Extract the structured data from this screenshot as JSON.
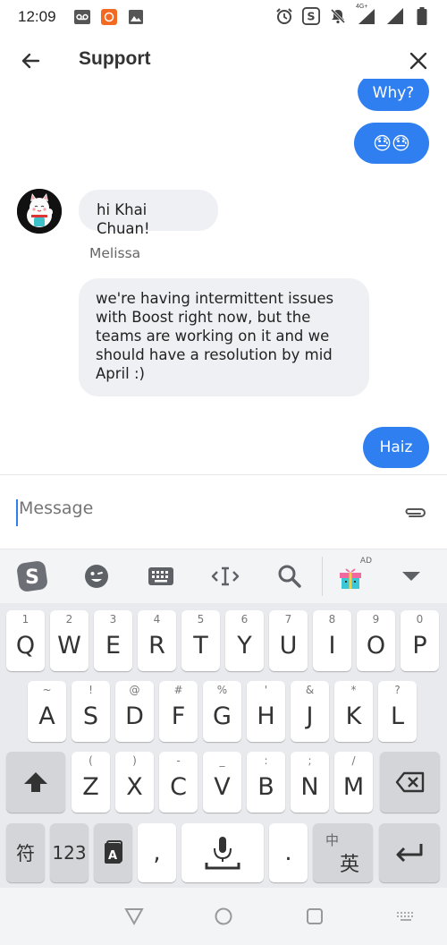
{
  "status_bar": {
    "time": "12:09",
    "net_label": "4G+"
  },
  "header": {
    "title": "Support"
  },
  "messages": [
    {
      "side": "out",
      "text": "Why?"
    },
    {
      "side": "out",
      "text": "😓😓"
    },
    {
      "side": "in",
      "text": "hi Khai Chuan!"
    },
    {
      "side": "in",
      "sender": "Melissa",
      "text": "we're having intermittent issues with Boost right now, but the teams are working on it and we should have a resolution by mid April :)"
    },
    {
      "side": "out",
      "text": "Haiz"
    }
  ],
  "composer": {
    "placeholder": "Message"
  },
  "keyboard": {
    "toolbar_ad": "AD",
    "row1": [
      {
        "hint": "1",
        "key": "Q"
      },
      {
        "hint": "2",
        "key": "W"
      },
      {
        "hint": "3",
        "key": "E"
      },
      {
        "hint": "4",
        "key": "R"
      },
      {
        "hint": "5",
        "key": "T"
      },
      {
        "hint": "6",
        "key": "Y"
      },
      {
        "hint": "7",
        "key": "U"
      },
      {
        "hint": "8",
        "key": "I"
      },
      {
        "hint": "9",
        "key": "O"
      },
      {
        "hint": "0",
        "key": "P"
      }
    ],
    "row2": [
      {
        "hint": "~",
        "key": "A"
      },
      {
        "hint": "!",
        "key": "S"
      },
      {
        "hint": "@",
        "key": "D"
      },
      {
        "hint": "#",
        "key": "F"
      },
      {
        "hint": "%",
        "key": "G"
      },
      {
        "hint": "'",
        "key": "H"
      },
      {
        "hint": "&",
        "key": "J"
      },
      {
        "hint": "*",
        "key": "K"
      },
      {
        "hint": "?",
        "key": "L"
      }
    ],
    "row3": [
      {
        "hint": "(",
        "key": "Z"
      },
      {
        "hint": ")",
        "key": "X"
      },
      {
        "hint": "-",
        "key": "C"
      },
      {
        "hint": "_",
        "key": "V"
      },
      {
        "hint": ":",
        "key": "B"
      },
      {
        "hint": ";",
        "key": "N"
      },
      {
        "hint": "/",
        "key": "M"
      }
    ],
    "symbol_key": "符",
    "num_key": "123",
    "comma_key": ",",
    "period_key": ".",
    "lang_key_top": "中",
    "lang_key_bottom": "英"
  }
}
